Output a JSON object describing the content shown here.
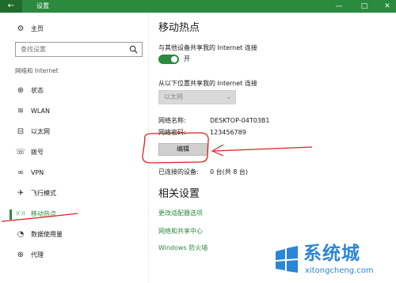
{
  "window": {
    "title": "设置",
    "back_icon": "←",
    "minimize_icon": "—",
    "maximize_icon": "□",
    "close_icon": "✕"
  },
  "sidebar": {
    "home": {
      "label": "主页",
      "icon": "gear-icon",
      "glyph": "⚙"
    },
    "search_placeholder": "查找设置",
    "section": "网络和 Internet",
    "items": [
      {
        "label": "状态",
        "icon": "status-icon",
        "glyph": "⊕"
      },
      {
        "label": "WLAN",
        "icon": "wifi-icon",
        "glyph": "≋"
      },
      {
        "label": "以太网",
        "icon": "ethernet-icon",
        "glyph": "⊟"
      },
      {
        "label": "拨号",
        "icon": "dialup-icon",
        "glyph": "☏"
      },
      {
        "label": "VPN",
        "icon": "vpn-icon",
        "glyph": "∞"
      },
      {
        "label": "飞行模式",
        "icon": "airplane-icon",
        "glyph": "✈"
      },
      {
        "label": "移动热点",
        "icon": "hotspot-icon",
        "glyph": "((·))",
        "active": true
      },
      {
        "label": "数据使用量",
        "icon": "data-usage-icon",
        "glyph": "◔"
      },
      {
        "label": "代理",
        "icon": "proxy-icon",
        "glyph": "⊕"
      }
    ]
  },
  "main": {
    "title": "移动热点",
    "share_label": "与其他设备共享我的 Internet 连接",
    "toggle_state": "开",
    "share_from_label": "从以下位置共享我的 Internet 连接",
    "share_from_value": "以太网",
    "network_name_label": "网络名称:",
    "network_name_value": "DESKTOP-04T03B1",
    "network_password_label": "网络密码:",
    "network_password_value": "123456789",
    "edit_button": "编辑",
    "connected_label": "已连接的设备:",
    "connected_value": "0 台(共 8 台)",
    "related_title": "相关设置",
    "links": [
      "更改适配器选项",
      "网络和共享中心",
      "Windows 防火墙"
    ]
  },
  "watermark": {
    "text": "系统城",
    "url": "xitongcheng.com"
  },
  "colors": {
    "accent": "#2b8a3e",
    "annotation": "#e02020",
    "watermark": "#2b86d6"
  }
}
